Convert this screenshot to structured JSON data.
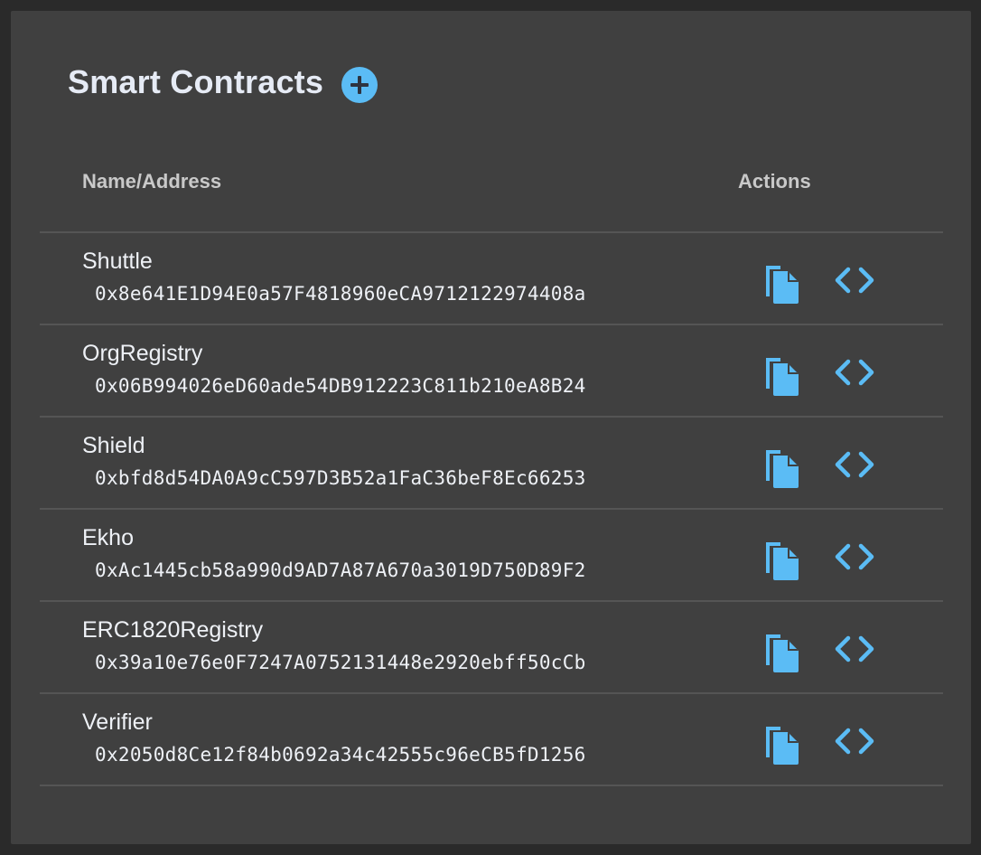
{
  "header": {
    "title": "Smart Contracts",
    "add_icon": "plus-circle-icon"
  },
  "table": {
    "columns": [
      "Name/Address",
      "Actions"
    ],
    "rows": [
      {
        "name": "Shuttle",
        "address": "0x8e641E1D94E0a57F4818960eCA9712122974408a"
      },
      {
        "name": "OrgRegistry",
        "address": "0x06B994026eD60ade54DB912223C811b210eA8B24"
      },
      {
        "name": "Shield",
        "address": "0xbfd8d54DA0A9cC597D3B52a1FaC36beF8Ec66253"
      },
      {
        "name": "Ekho",
        "address": "0xAc1445cb58a990d9AD7A87A670a3019D750D89F2"
      },
      {
        "name": "ERC1820Registry",
        "address": "0x39a10e76e0F7247A0752131448e2920ebff50cCb"
      },
      {
        "name": "Verifier",
        "address": "0x2050d8Ce12f84b0692a34c42555c96eCB5fD1256"
      }
    ],
    "actions": {
      "copy_icon": "copy-icon",
      "code_icon": "code-icon"
    }
  },
  "colors": {
    "accent": "#5bbcf5",
    "panel_bg": "#404040",
    "page_bg": "#2a2a2a",
    "text": "#eef1f6",
    "header_text": "#c9c9c9"
  }
}
